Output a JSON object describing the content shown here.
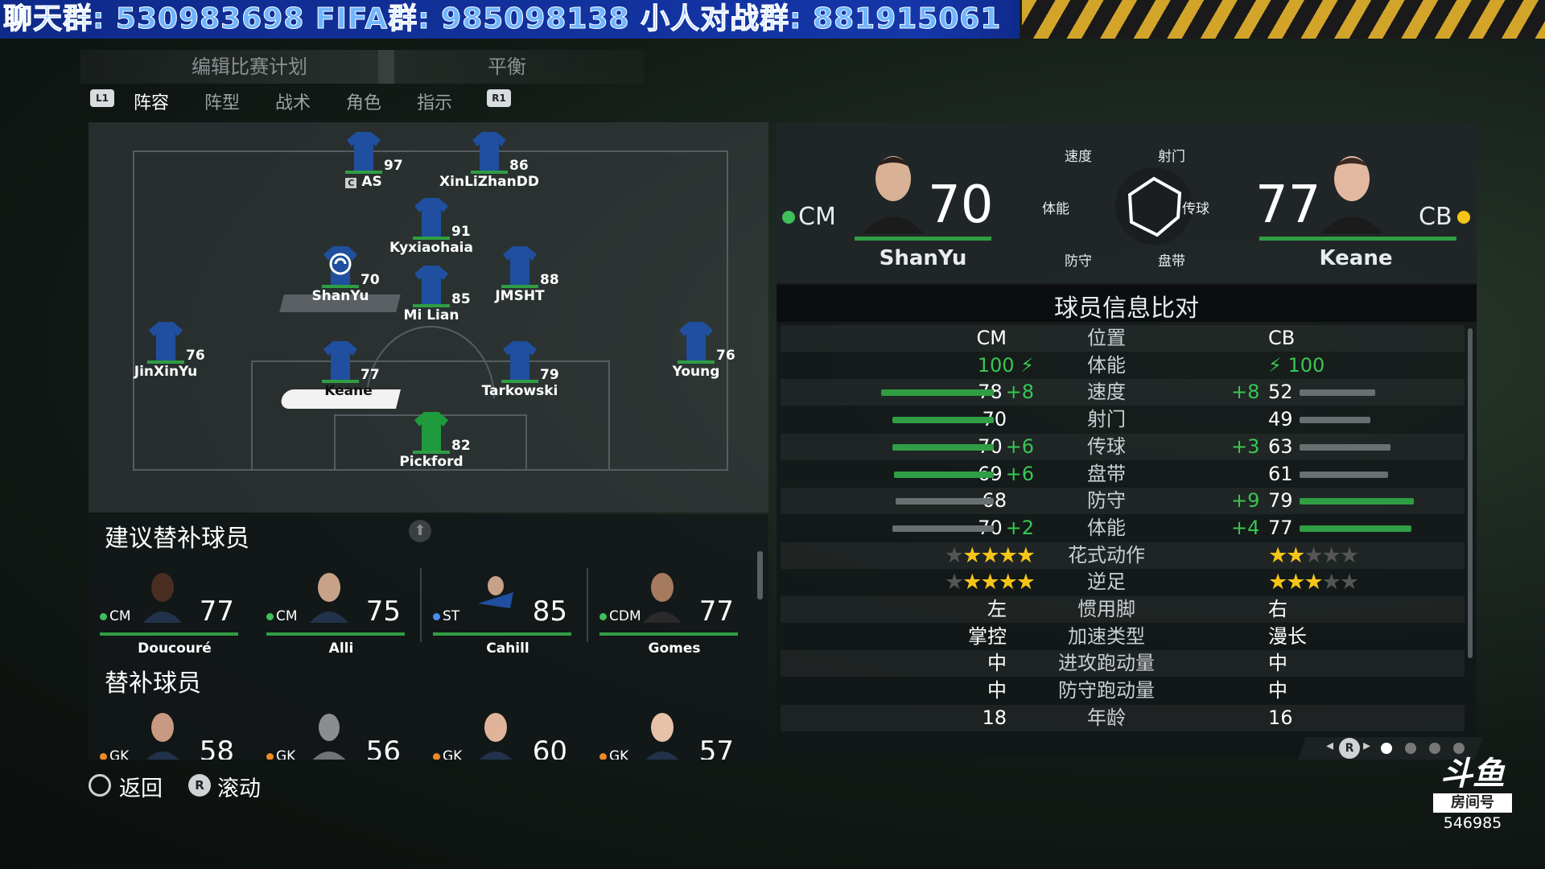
{
  "banner": {
    "text": "聊天群: 530983698    FIFA群: 985098138    小人对战群: 881915061"
  },
  "header": {
    "plan_tab": "编辑比赛计划",
    "balance_tab": "平衡",
    "l1": "L1",
    "r1": "R1",
    "subtabs": [
      "阵容",
      "阵型",
      "战术",
      "角色",
      "指示"
    ]
  },
  "pitch_players": [
    {
      "name": "AS",
      "rating": "97",
      "captain": "C"
    },
    {
      "name": "XinLiZhanDD",
      "rating": "86"
    },
    {
      "name": "Kyxiaohaia",
      "rating": "91"
    },
    {
      "name": "ShanYu",
      "rating": "70"
    },
    {
      "name": "Mi Lian",
      "rating": "85"
    },
    {
      "name": "JMSHT",
      "rating": "88"
    },
    {
      "name": "JinXinYu",
      "rating": "76"
    },
    {
      "name": "Young",
      "rating": "76"
    },
    {
      "name": "Keane",
      "rating": "77"
    },
    {
      "name": "Tarkowski",
      "rating": "79"
    },
    {
      "name": "Pickford",
      "rating": "82"
    }
  ],
  "suggested": {
    "title": "建议替补球员",
    "players": [
      {
        "pos": "CM",
        "rating": "77",
        "name": "Doucouré",
        "dot": "#3fbf5a"
      },
      {
        "pos": "CM",
        "rating": "75",
        "name": "Alli",
        "dot": "#3fbf5a"
      },
      {
        "pos": "ST",
        "rating": "85",
        "name": "Cahill",
        "dot": "#4a8cf0"
      },
      {
        "pos": "CDM",
        "rating": "77",
        "name": "Gomes",
        "dot": "#3fbf5a"
      }
    ]
  },
  "bench": {
    "title": "替补球员",
    "players": [
      {
        "pos": "GK",
        "rating": "58",
        "dot": "#f08a24"
      },
      {
        "pos": "GK",
        "rating": "56",
        "dot": "#f08a24"
      },
      {
        "pos": "GK",
        "rating": "60",
        "dot": "#f08a24"
      },
      {
        "pos": "GK",
        "rating": "57",
        "dot": "#f08a24"
      }
    ]
  },
  "compare": {
    "left": {
      "pos": "CM",
      "rating": "70",
      "name": "ShanYu"
    },
    "right": {
      "pos": "CB",
      "rating": "77",
      "name": "Keane"
    },
    "radar": {
      "top_left": "速度",
      "top_right": "射门",
      "mid_left": "体能",
      "mid_right": "传球",
      "bot_left": "防守",
      "bot_right": "盘带"
    },
    "title": "球员信息比对",
    "rows": [
      {
        "label": "位置",
        "left": "CM",
        "right": "CB"
      },
      {
        "label": "体能",
        "left": "100",
        "right": "100"
      },
      {
        "label": "速度",
        "left": "78",
        "lboost": "+8",
        "right": "52",
        "rboost": "+8",
        "lbar": 0.78,
        "rbar": 0.52
      },
      {
        "label": "射门",
        "left": "70",
        "right": "49",
        "lbar": 0.7,
        "rbar": 0.49
      },
      {
        "label": "传球",
        "left": "70",
        "lboost": "+6",
        "right": "63",
        "rboost": "+3",
        "lbar": 0.7,
        "rbar": 0.63
      },
      {
        "label": "盘带",
        "left": "69",
        "lboost": "+6",
        "right": "61",
        "lbar": 0.69,
        "rbar": 0.61
      },
      {
        "label": "防守",
        "left": "68",
        "right": "79",
        "rboost": "+9",
        "lbar": 0.68,
        "rbar": 0.79
      },
      {
        "label": "体能",
        "left": "70",
        "lboost": "+2",
        "right": "77",
        "rboost": "+4",
        "lbar": 0.7,
        "rbar": 0.77
      },
      {
        "label": "花式动作",
        "lstars": 4,
        "rstars": 2
      },
      {
        "label": "逆足",
        "lstars": 4,
        "rstars": 3
      },
      {
        "label": "惯用脚",
        "left": "左",
        "right": "右"
      },
      {
        "label": "加速类型",
        "left": "掌控",
        "right": "漫长"
      },
      {
        "label": "进攻跑动量",
        "left": "中",
        "right": "中"
      },
      {
        "label": "防守跑动量",
        "left": "中",
        "right": "中"
      },
      {
        "label": "年龄",
        "left": "18",
        "right": "16"
      }
    ]
  },
  "footer": {
    "back": "返回",
    "scroll": "滚动",
    "r": "R"
  },
  "logo": {
    "brand": "斗鱼",
    "room_label": "房间号",
    "room": "546985"
  },
  "colors": {
    "accent_green": "#2f9e44",
    "boost_green": "#39c653",
    "star": "#f5c518",
    "gk_jersey": "#1f9a3d",
    "jersey": "#1f4f9e"
  }
}
